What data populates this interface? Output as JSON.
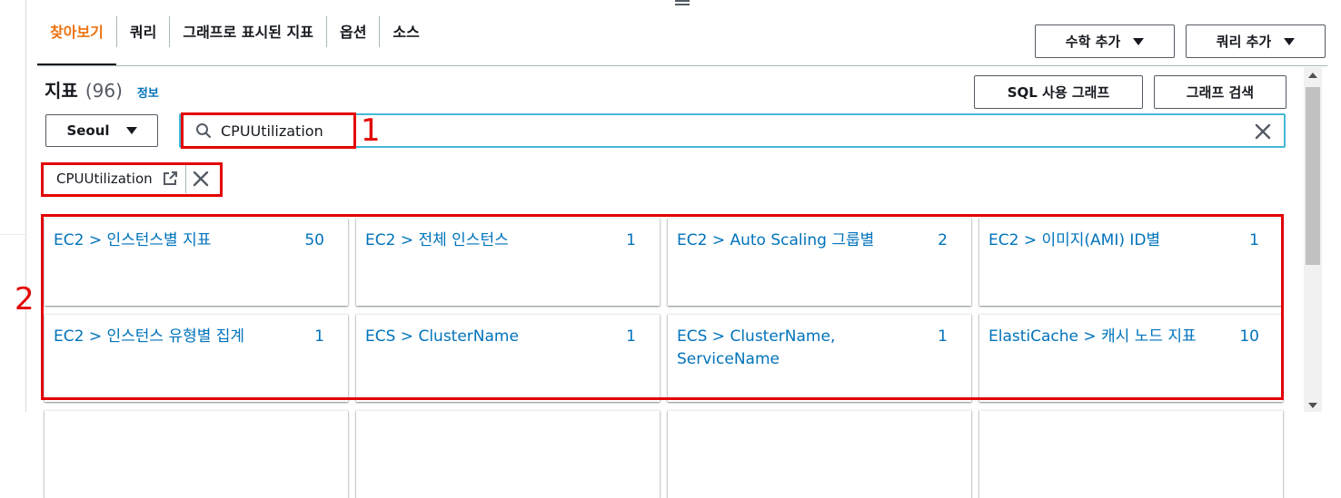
{
  "tabs": [
    {
      "label": "찾아보기",
      "active": true
    },
    {
      "label": "쿼리"
    },
    {
      "label": "그래프로 표시된 지표"
    },
    {
      "label": "옵션"
    },
    {
      "label": "소스"
    }
  ],
  "top_buttons": {
    "math": "수학 추가",
    "query": "쿼리 추가"
  },
  "metrics_header": {
    "title": "지표",
    "count": "(96)",
    "info": "정보"
  },
  "action_buttons": {
    "sql": "SQL 사용 그래프",
    "search": "그래프 검색"
  },
  "region": "Seoul",
  "search": {
    "value": "CPUUtilization"
  },
  "token": {
    "label": "CPUUtilization"
  },
  "annotations": {
    "one": "1",
    "two": "2"
  },
  "colors": {
    "accent": "#ec7211",
    "link": "#0073bb",
    "annotation": "#e30000",
    "focus": "#44b9d6"
  },
  "cards": [
    {
      "label": "EC2 > 인스턴스별 지표",
      "count": "50"
    },
    {
      "label": "EC2 > 전체 인스턴스",
      "count": "1"
    },
    {
      "label": "EC2 > Auto Scaling 그룹별",
      "count": "2"
    },
    {
      "label": "EC2 > 이미지(AMI) ID별",
      "count": "1"
    },
    {
      "label": "EC2 > 인스턴스 유형별 집계",
      "count": "1"
    },
    {
      "label": "ECS > ClusterName",
      "count": "1"
    },
    {
      "label": "ECS > ClusterName, ServiceName",
      "count": "1"
    },
    {
      "label": "ElastiCache > 캐시 노드 지표",
      "count": "10"
    }
  ]
}
